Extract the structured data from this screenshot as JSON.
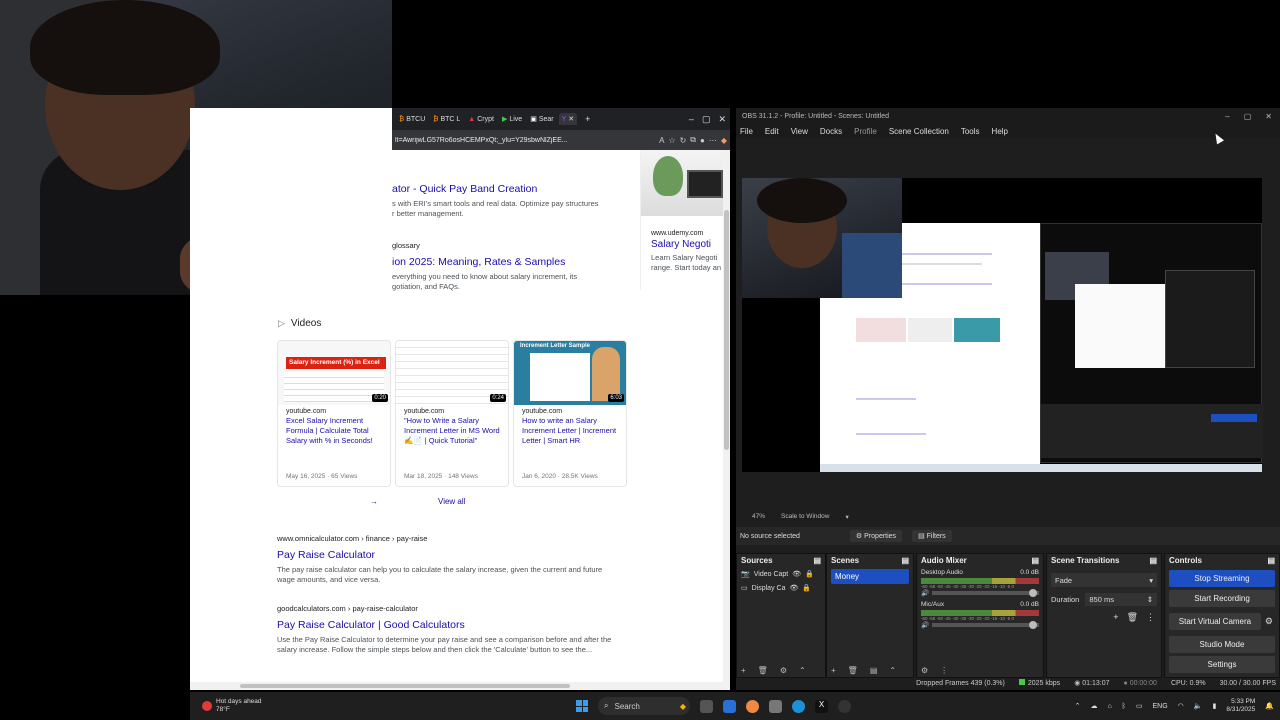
{
  "browser": {
    "tabs": [
      "BTCU",
      "BTC L",
      "Crypt",
      "Live",
      "Sear",
      ""
    ],
    "url": "lt=AwrijwLG57Ro6osHCEMPxQt;_ylu=Y29sbwNlZjEE...",
    "results": [
      {
        "title": "ator - Quick Pay Band Creation",
        "snippet": "s with ERI's smart tools and real data. Optimize pay structures\nr better management."
      },
      {
        "cite": "glossary",
        "title": "ion 2025: Meaning, Rates & Samples",
        "snippet": "everything you need to know about salary increment, its\ngotiation, and FAQs."
      }
    ],
    "side_card": {
      "domain": "www.udemy.com",
      "title": "Salary Negoti",
      "snippet": "Learn Salary Negoti\nrange. Start today an"
    },
    "videos_heading": "Videos",
    "videos": [
      {
        "thumb_label": "Salary Increment (%) in Excel",
        "duration": "0:20",
        "source": "youtube.com",
        "title": "Excel Salary Increment Formula | Calculate Total Salary with % in Seconds!",
        "meta": "May 16, 2025 · 65 Views"
      },
      {
        "thumb_label": "",
        "duration": "0:24",
        "source": "youtube.com",
        "title": "\"How to Write a Salary Increment Letter in MS Word ✍️📄 | Quick Tutorial\"",
        "meta": "Mar 18, 2025 · 148 Views"
      },
      {
        "thumb_label": "Increment Letter Sample",
        "duration": "6:03",
        "source": "youtube.com",
        "title": "How to write an Salary Increment Letter | Increment Letter | Smart HR",
        "meta": "Jan 6, 2020 · 28.5K Views"
      }
    ],
    "view_all": "View all",
    "result3": {
      "cite": "www.omnicalculator.com › finance › pay-raise",
      "title": "Pay Raise Calculator",
      "snippet": "The pay raise calculator can help you to calculate the salary increase, given the current and future\nwage amounts, and vice versa."
    },
    "result4": {
      "cite": "goodcalculators.com › pay-raise-calculator",
      "title": "Pay Raise Calculator | Good Calculators",
      "snippet": "Use the Pay Raise Calculator to determine your pay raise and see a comparison before and after the\nsalary increase. Follow the simple steps below and then click the 'Calculate' button to see the..."
    }
  },
  "obs": {
    "title": "OBS 31.1.2 - Profile: Untitled - Scenes: Untitled",
    "menu": [
      "File",
      "Edit",
      "View",
      "Docks",
      "Profile",
      "Scene Collection",
      "Tools",
      "Help"
    ],
    "zoom": "47%",
    "scale_mode": "Scale to Window",
    "no_source": "No source selected",
    "properties": "Properties",
    "filters": "Filters",
    "sources_title": "Sources",
    "sources": [
      "Video Capt",
      "Display Ca"
    ],
    "scenes_title": "Scenes",
    "scenes": [
      "Money"
    ],
    "mixer_title": "Audio Mixer",
    "mixer": [
      {
        "name": "Desktop Audio",
        "db": "0.0 dB"
      },
      {
        "name": "Mic/Aux",
        "db": "0.0 dB"
      }
    ],
    "meter_scale": "-60 -55 -50 -45 -40 -35 -30 -25 -20 -15 -10 -5 0",
    "transitions_title": "Scene Transitions",
    "transition": "Fade",
    "duration_label": "Duration",
    "duration_value": "850 ms",
    "controls_title": "Controls",
    "controls": [
      "Stop Streaming",
      "Start Recording",
      "Start Virtual Camera",
      "Studio Mode",
      "Settings"
    ],
    "status": {
      "dropped": "Dropped Frames 439 (0.3%)",
      "bitrate": "2025 kbps",
      "stream_time": "01:13:07",
      "rec_time": "00:00:00",
      "cpu": "CPU: 0.9%",
      "fps": "30.00 / 30.00 FPS"
    }
  },
  "taskbar": {
    "weather_line1": "Hot days ahead",
    "weather_line2": "78°F",
    "search": "Search",
    "lang": "ENG",
    "time": "5:33 PM",
    "date": "8/31/2025"
  }
}
